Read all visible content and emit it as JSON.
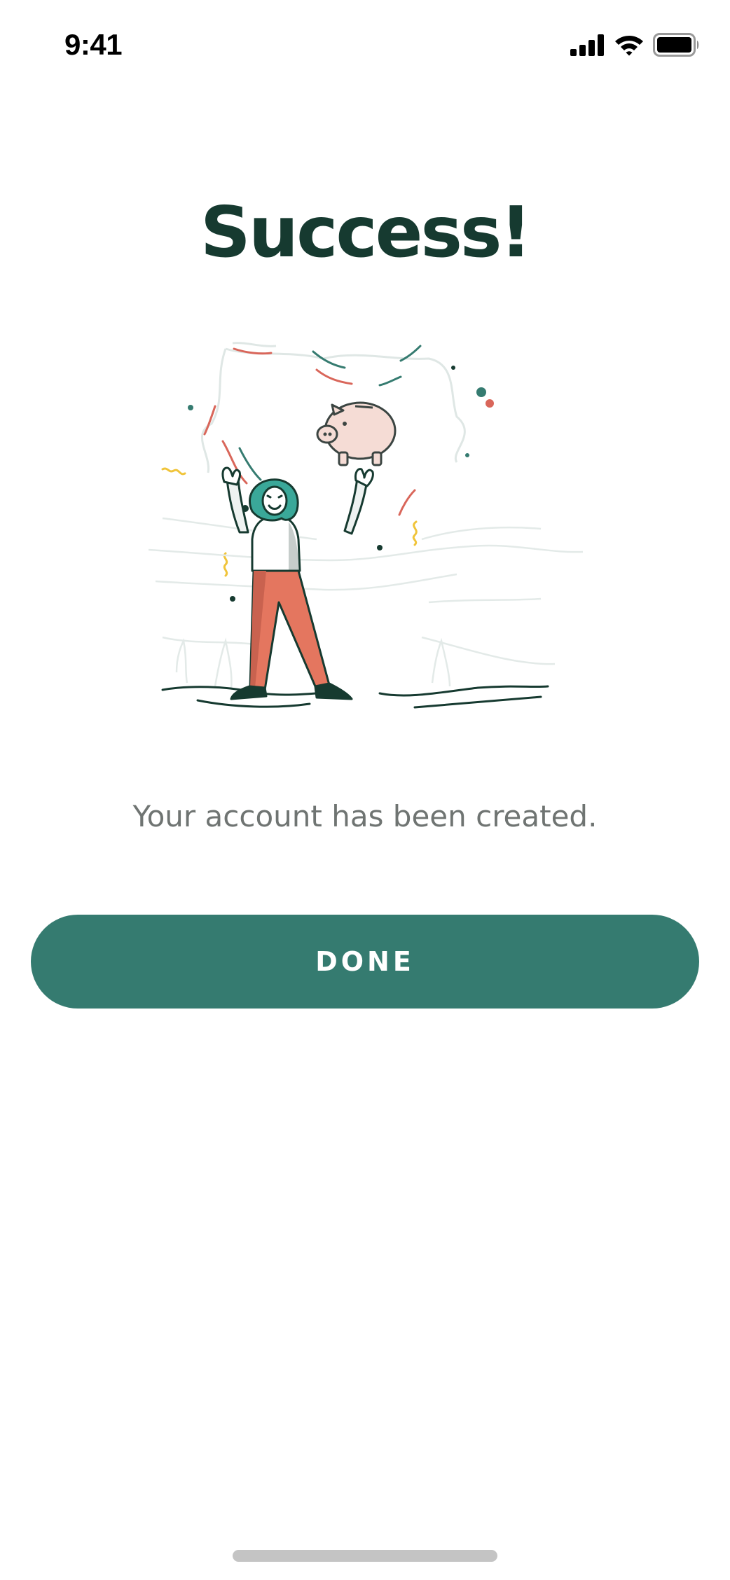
{
  "status_bar": {
    "time": "9:41",
    "icons": [
      "cellular-signal-icon",
      "wifi-icon",
      "battery-icon"
    ]
  },
  "page": {
    "title": "Success!",
    "illustration": "celebration-illustration",
    "message": "Your account has been created.",
    "done_label": "DONE"
  },
  "colors": {
    "title": "#163a30",
    "message": "#6f7472",
    "button_background": "#357b70",
    "button_text": "#ffffff",
    "home_indicator": "#c4c4c4",
    "accent_red": "#d9665a",
    "accent_teal": "#3aa899"
  }
}
